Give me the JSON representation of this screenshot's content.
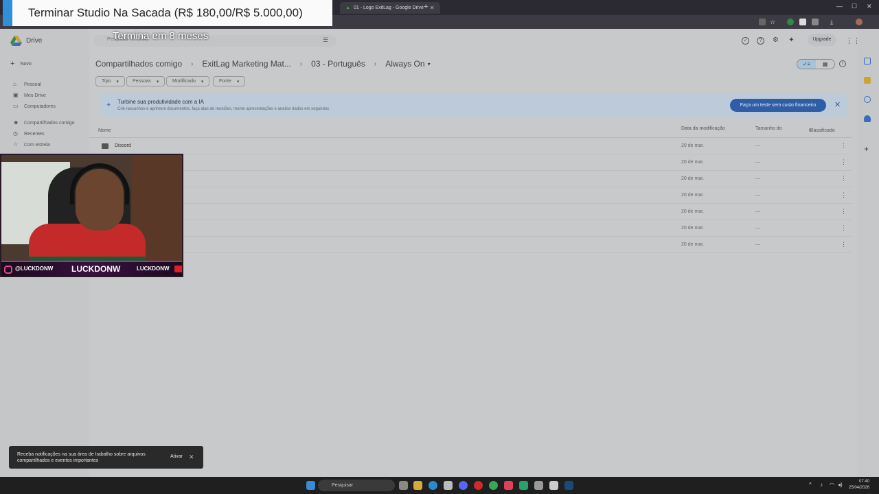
{
  "browser": {
    "tabs": [
      {
        "title": "01 - Logo ExitLag - Google Drive",
        "active": false
      }
    ]
  },
  "overlay": {
    "goal_title": "Terminar Studio Na Sacada (R$ 180,00/R$ 5.000,00)",
    "goal_sub": "Termina em 8 meses",
    "webcam_instagram": "@LUCKDONW",
    "webcam_name": "LUCKDONW",
    "webcam_youtube": "LUCKDONW",
    "goal_progress": 0.036
  },
  "drive": {
    "logo_label": "Drive",
    "new_label": "Novo",
    "nav": [
      {
        "label": "Pessoal",
        "icon": "home-icon"
      },
      {
        "label": "Meu Drive",
        "icon": "drive-icon"
      },
      {
        "label": "Computadores",
        "icon": "computer-icon"
      },
      {
        "label": "Compartilhados comigo",
        "icon": "people-icon"
      },
      {
        "label": "Recentes",
        "icon": "clock-icon"
      },
      {
        "label": "Com estrela",
        "icon": "star-icon"
      }
    ],
    "search_placeholder": "Pesquisar no Drive",
    "upgrade_label": "Upgrade",
    "breadcrumb": [
      "Compartilhados comigo",
      "ExitLag Marketing Mat...",
      "03 - Português",
      "Always On"
    ],
    "filters": [
      "Tipo",
      "Pessoas",
      "Modificado",
      "Fonte"
    ],
    "banner": {
      "title": "Turbine sua produtividade com a IA",
      "subtitle": "Crie rascunhos e aprimore documentos, faça atas de reuniões, monte apresentações e analise dados em segundos",
      "button": "Faça um teste sem custo financeiro"
    },
    "columns": {
      "name": "Nome",
      "modified": "Data da modificação",
      "size": "Tamanho do",
      "sort": "Classificado"
    },
    "rows": [
      {
        "name": "Discord",
        "date": "20 de mar.",
        "size": "—"
      },
      {
        "name": "",
        "date": "20 de mar.",
        "size": "—"
      },
      {
        "name": "",
        "date": "20 de mar.",
        "size": "—"
      },
      {
        "name": "",
        "date": "20 de mar.",
        "size": "—"
      },
      {
        "name": "",
        "date": "20 de mar.",
        "size": "—"
      },
      {
        "name": "",
        "date": "20 de mar.",
        "size": "—"
      },
      {
        "name": "",
        "date": "20 de mar.",
        "size": "—"
      }
    ],
    "toast": {
      "message": "Receba notificações na sua área de trabalho sobre arquivos compartilhados e eventos importantes",
      "action": "Ativar"
    }
  },
  "taskbar": {
    "search_label": "Pesquisar",
    "time": "07:40",
    "date": "25/04/2026"
  }
}
